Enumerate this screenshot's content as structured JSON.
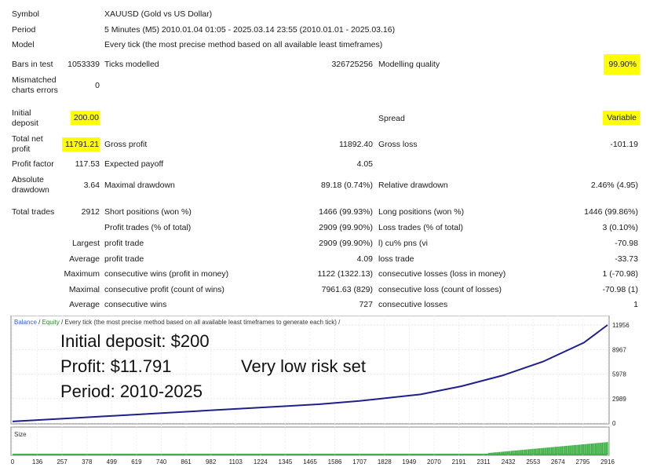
{
  "header": {
    "symbol_label": "Symbol",
    "symbol_value": "XAUUSD (Gold vs US Dollar)",
    "period_label": "Period",
    "period_value": "5 Minutes (M5) 2010.01.04 01:05 - 2025.03.14 23:55 (2010.01.01 - 2025.03.16)",
    "model_label": "Model",
    "model_value": "Every tick (the most precise method based on all available least timeframes)"
  },
  "stats": {
    "bars_label": "Bars in test",
    "bars_value": "1053339",
    "ticks_label": "Ticks modelled",
    "ticks_value": "326725256",
    "quality_label": "Modelling quality",
    "quality_value": "99.90%",
    "mismatch_label_1": "Mismatched",
    "mismatch_label_2": "charts errors",
    "mismatch_value": "0",
    "deposit_label_1": "Initial",
    "deposit_label_2": "deposit",
    "deposit_value": "200.00",
    "spread_label": "Spread",
    "spread_value": "Variable",
    "netprofit_label_1": "Total net",
    "netprofit_label_2": "profit",
    "netprofit_value": "11791.21",
    "gross_profit_label": "Gross profit",
    "gross_profit_value": "11892.40",
    "gross_loss_label": "Gross loss",
    "gross_loss_value": "-101.19",
    "pf_label": "Profit factor",
    "pf_value": "117.53",
    "payoff_label": "Expected payoff",
    "payoff_value": "4.05",
    "absdd_label_1": "Absolute",
    "absdd_label_2": "drawdown",
    "absdd_value": "3.64",
    "maxdd_label": "Maximal drawdown",
    "maxdd_value": "89.18 (0.74%)",
    "reldd_label": "Relative drawdown",
    "reldd_value": "2.46% (4.95)",
    "trades_label": "Total trades",
    "trades_value": "2912",
    "short_label": "Short positions (won %)",
    "short_value": "1466 (99.93%)",
    "long_label": "Long positions (won %)",
    "long_value": "1446 (99.86%)",
    "profit_trades_label": "Profit trades (% of total)",
    "profit_trades_value": "2909 (99.90%)",
    "loss_trades_label": "Loss trades (% of total)",
    "loss_trades_value": "3 (0.10%)",
    "largest_label": "Largest",
    "largest_profit_label": "profit trade",
    "largest_profit_value": "2909 (99.90%)",
    "largest_loss_label": "l) cu% pns (vi",
    "largest_loss_value": "-70.98",
    "average_label": "Average",
    "avg_profit_label": "profit trade",
    "avg_profit_value": "4.09",
    "avg_loss_label": "loss trade",
    "avg_loss_value": "-33.73",
    "maximum_label": "Maximum",
    "max_wins_label": "consecutive wins (profit in money)",
    "max_wins_value": "1122 (1322.13)",
    "max_losses_label": "consecutive losses (loss in money)",
    "max_losses_value": "1 (-70.98)",
    "maximal_label": "Maximal",
    "maximal_profit_label": "consecutive profit (count of wins)",
    "maximal_profit_value": "7961.63 (829)",
    "maximal_loss_label": "consecutive loss (count of losses)",
    "maximal_loss_value": "-70.98 (1)",
    "average2_label": "Average",
    "avg_wins_label": "consecutive wins",
    "avg_wins_value": "727",
    "avg_losses_label": "consecutive losses",
    "avg_losses_value": "1"
  },
  "chart_legend": {
    "balance": "Balance",
    "slash1": " / ",
    "equity": "Equity",
    "rest": " / Every tick (the most precise method based on all available least timeframes to generate each tick) /"
  },
  "overlay": {
    "line1": "Initial deposit: $200",
    "line2": "Profit: $11.791",
    "line3": "Very low risk set",
    "line4": "Period: 2010-2025"
  },
  "size_label": "Size",
  "colors": {
    "balance": "#1f1f8c",
    "equity": "#2e8b2e",
    "highlight": "#ffff00",
    "volume": "#3cb043",
    "legend_blue": "#2f5fd0"
  },
  "chart_data": {
    "type": "line",
    "series": [
      {
        "name": "Balance",
        "x": [
          0,
          500,
          1000,
          1500,
          1700,
          2000,
          2200,
          2400,
          2600,
          2800,
          2916
        ],
        "values": [
          200,
          900,
          1600,
          2300,
          2700,
          3500,
          4500,
          5800,
          7500,
          9800,
          11956
        ]
      }
    ],
    "y_ticks": [
      "11956",
      "8967",
      "5978",
      "2989",
      "0"
    ],
    "y_values": [
      11956,
      8967,
      5978,
      2989,
      0
    ],
    "x_ticks": [
      "0",
      "136",
      "257",
      "378",
      "499",
      "619",
      "740",
      "861",
      "982",
      "1103",
      "1224",
      "1345",
      "1465",
      "1586",
      "1707",
      "1828",
      "1949",
      "2070",
      "2191",
      "2311",
      "2432",
      "2553",
      "2674",
      "2795",
      "2916"
    ],
    "ylim": [
      0,
      11956
    ],
    "xlim": [
      0,
      2916
    ],
    "grid": true
  }
}
